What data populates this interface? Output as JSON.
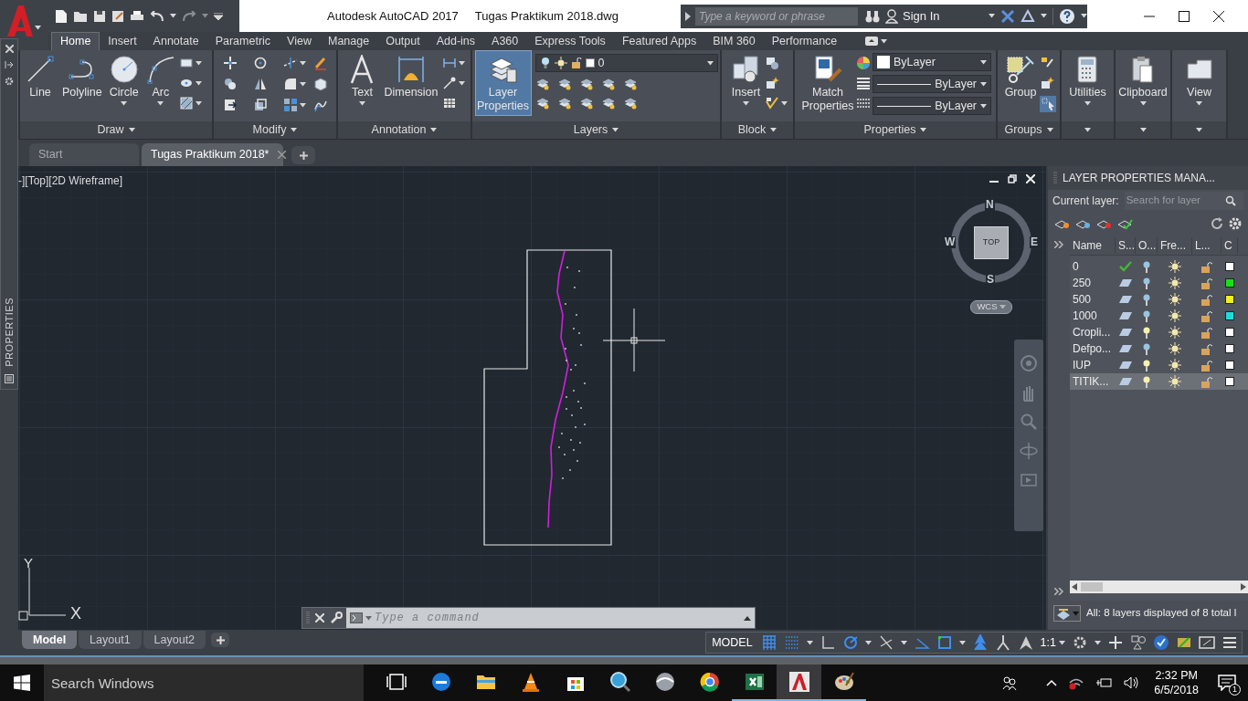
{
  "title_bar": {
    "app_name": "Autodesk AutoCAD 2017",
    "file_name": "Tugas Praktikum 2018.dwg",
    "search_placeholder": "Type a keyword or phrase",
    "sign_in": "Sign In"
  },
  "ribbon_tabs": [
    {
      "label": "Home",
      "selected": true
    },
    {
      "label": "Insert",
      "selected": false
    },
    {
      "label": "Annotate",
      "selected": false
    },
    {
      "label": "Parametric",
      "selected": false
    },
    {
      "label": "View",
      "selected": false
    },
    {
      "label": "Manage",
      "selected": false
    },
    {
      "label": "Output",
      "selected": false
    },
    {
      "label": "Add-ins",
      "selected": false
    },
    {
      "label": "A360",
      "selected": false
    },
    {
      "label": "Express Tools",
      "selected": false
    },
    {
      "label": "Featured Apps",
      "selected": false
    },
    {
      "label": "BIM 360",
      "selected": false
    },
    {
      "label": "Performance",
      "selected": false
    }
  ],
  "ribbon_panels": [
    {
      "kind": "draw",
      "title": "Draw",
      "tools": [
        {
          "kind": "line",
          "label": "Line",
          "on": false,
          "dropdown": false
        },
        {
          "kind": "polyline",
          "label": "Polyline",
          "on": false,
          "dropdown": false
        },
        {
          "kind": "circle",
          "label": "Circle",
          "on": false,
          "dropdown": true
        },
        {
          "kind": "arc",
          "label": "Arc",
          "on": false,
          "dropdown": true
        }
      ]
    },
    {
      "kind": "modify",
      "title": "Modify"
    },
    {
      "kind": "annotation",
      "title": "Annotation",
      "tools": [
        {
          "kind": "text",
          "label": "Text",
          "on": false,
          "dropdown": true
        },
        {
          "kind": "dimension",
          "label": "Dimension",
          "on": false,
          "dropdown": false
        }
      ]
    },
    {
      "kind": "layers",
      "title": "Layers",
      "layer_combo": "0",
      "tools": [
        {
          "kind": "layer_properties",
          "label": "Layer Properties",
          "on": true,
          "dropdown": false
        }
      ]
    },
    {
      "kind": "block",
      "title": "Block",
      "tools": [
        {
          "kind": "insert",
          "label": "Insert",
          "on": false,
          "dropdown": true
        }
      ]
    },
    {
      "kind": "properties",
      "title": "Properties",
      "combos": [
        "ByLayer",
        "ByLayer",
        "ByLayer"
      ],
      "tools": [
        {
          "kind": "match_properties",
          "label": "Match Properties",
          "on": false,
          "dropdown": false
        }
      ]
    },
    {
      "kind": "groups",
      "title": "Groups",
      "tools": [
        {
          "kind": "group",
          "label": "Group",
          "on": false,
          "dropdown": false
        }
      ]
    },
    {
      "kind": "utilities",
      "tools": [
        {
          "kind": "utilities",
          "label": "Utilities",
          "on": false,
          "dropdown": true
        }
      ]
    },
    {
      "kind": "clipboard",
      "tools": [
        {
          "kind": "clipboard",
          "label": "Clipboard",
          "on": false,
          "dropdown": true
        }
      ]
    },
    {
      "kind": "view",
      "tools": [
        {
          "kind": "view",
          "label": "View",
          "on": false,
          "dropdown": true
        }
      ]
    }
  ],
  "side_palette": {
    "label": "PROPERTIES"
  },
  "file_tabs": [
    {
      "label": "Start",
      "selected": false,
      "closable": false
    },
    {
      "label": "Tugas Praktikum 2018*",
      "selected": true,
      "closable": true
    }
  ],
  "viewport": {
    "label": "-][Top][2D Wireframe]",
    "viewcube": {
      "north": "N",
      "south": "S",
      "east": "E",
      "west": "W",
      "face": "TOP",
      "ucs_menu": "WCS"
    },
    "ucs_icon": {
      "x": "X",
      "y": "Y"
    }
  },
  "command_line": {
    "placeholder": "Type a command"
  },
  "layout_tabs": [
    {
      "label": "Model",
      "selected": true
    },
    {
      "label": "Layout1",
      "selected": false
    },
    {
      "label": "Layout2",
      "selected": false
    }
  ],
  "status_bar": {
    "space": "MODEL",
    "annotation_scale": "1:1"
  },
  "layer_manager": {
    "title": "LAYER PROPERTIES MANA...",
    "current_label": "Current layer:",
    "search_placeholder": "Search for layer",
    "columns": [
      "Name",
      "S...",
      "O...",
      "Fre...",
      "L...",
      "C"
    ],
    "layers": [
      {
        "name": "0",
        "current": true,
        "on": false,
        "frozen": false,
        "locked": false,
        "color": "#ffffff",
        "selected": false
      },
      {
        "name": "250",
        "current": false,
        "on": false,
        "frozen": false,
        "locked": false,
        "color": "#16e016",
        "selected": false
      },
      {
        "name": "500",
        "current": false,
        "on": false,
        "frozen": false,
        "locked": false,
        "color": "#f2f21a",
        "selected": false
      },
      {
        "name": "1000",
        "current": false,
        "on": false,
        "frozen": false,
        "locked": false,
        "color": "#1adede",
        "selected": false
      },
      {
        "name": "Cropli...",
        "current": false,
        "on": true,
        "frozen": false,
        "locked": false,
        "color": "#ffffff",
        "selected": false
      },
      {
        "name": "Defpo...",
        "current": false,
        "on": false,
        "frozen": false,
        "locked": false,
        "color": "#ffffff",
        "selected": false
      },
      {
        "name": "IUP",
        "current": false,
        "on": true,
        "frozen": false,
        "locked": false,
        "color": "#ffffff",
        "selected": false
      },
      {
        "name": "TITIK...",
        "current": false,
        "on": true,
        "frozen": false,
        "locked": false,
        "color": "#ffffff",
        "selected": true
      }
    ],
    "status": "All: 8 layers displayed of 8 total l"
  },
  "taskbar": {
    "search_placeholder": "Search Windows",
    "time": "2:32 PM",
    "date": "6/5/2018",
    "notification_count": "1",
    "apps": [
      {
        "kind": "task_view",
        "running": false,
        "selected": false
      },
      {
        "kind": "edge",
        "running": false,
        "selected": false
      },
      {
        "kind": "folder",
        "running": false,
        "selected": false
      },
      {
        "kind": "cone",
        "running": false,
        "selected": false
      },
      {
        "kind": "store",
        "running": false,
        "selected": false
      },
      {
        "kind": "magnifier",
        "running": false,
        "selected": false
      },
      {
        "kind": "disc",
        "running": false,
        "selected": false
      },
      {
        "kind": "chrome",
        "running": false,
        "selected": false
      },
      {
        "kind": "spreadsheet",
        "running": true,
        "selected": false
      },
      {
        "kind": "autocad",
        "running": true,
        "selected": true
      },
      {
        "kind": "paint",
        "running": true,
        "selected": false
      }
    ]
  }
}
